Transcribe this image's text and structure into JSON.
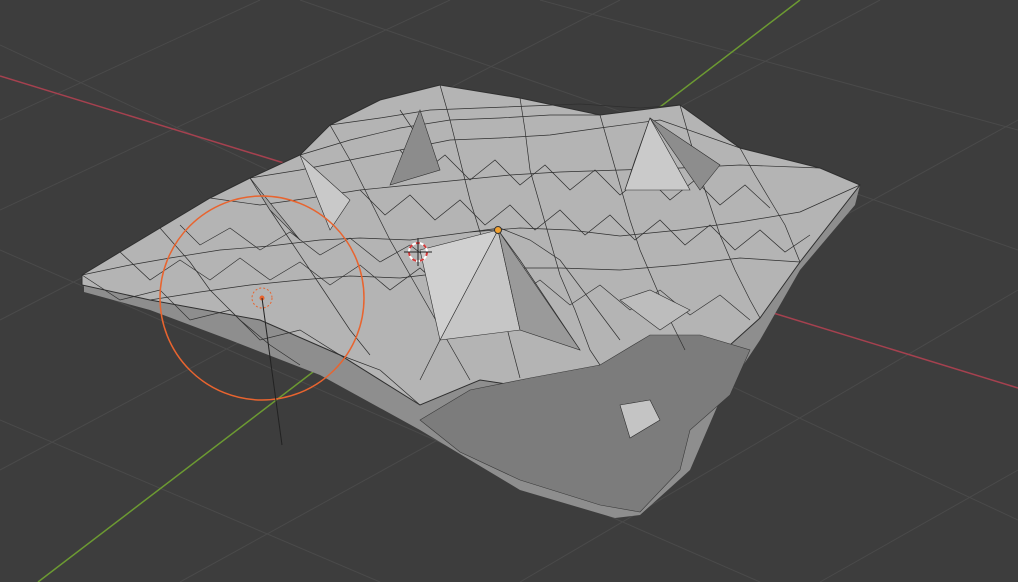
{
  "viewport": {
    "background_color": "#3d3d3d",
    "grid_color": "#4a4a4a",
    "x_axis_color": "#a5414f",
    "y_axis_color": "#6c9a32",
    "mesh_face_color": "#b4b4b4",
    "mesh_edge_color": "#2f2f2f",
    "brush_color": "#e8642f",
    "origin_color": "#f0a030",
    "cursor_icon": "3d-cursor-icon"
  }
}
